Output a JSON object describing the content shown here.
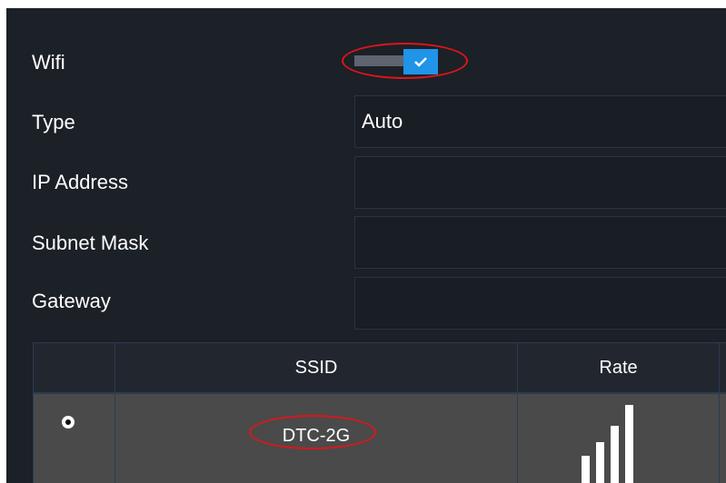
{
  "form": {
    "wifi_label": "Wifi",
    "wifi_enabled": true,
    "type_label": "Type",
    "type_value": "Auto",
    "ip_label": "IP Address",
    "ip_value": "",
    "subnet_label": "Subnet Mask",
    "subnet_value": "",
    "gateway_label": "Gateway",
    "gateway_value": ""
  },
  "table": {
    "headers": [
      "",
      "SSID",
      "Rate"
    ],
    "rows": [
      {
        "selected": true,
        "ssid": "DTC-2G",
        "signal_level": 4,
        "signal_max": 4
      }
    ]
  },
  "icons": {
    "toggle_check": "check-icon",
    "signal": "signal-strength-icon",
    "radio": "radio-selected-icon"
  },
  "colors": {
    "panel_bg": "#1c2027",
    "toggle_on": "#1f94e8",
    "annotation": "#e0141b",
    "selected_row": "#4a4a4a"
  }
}
